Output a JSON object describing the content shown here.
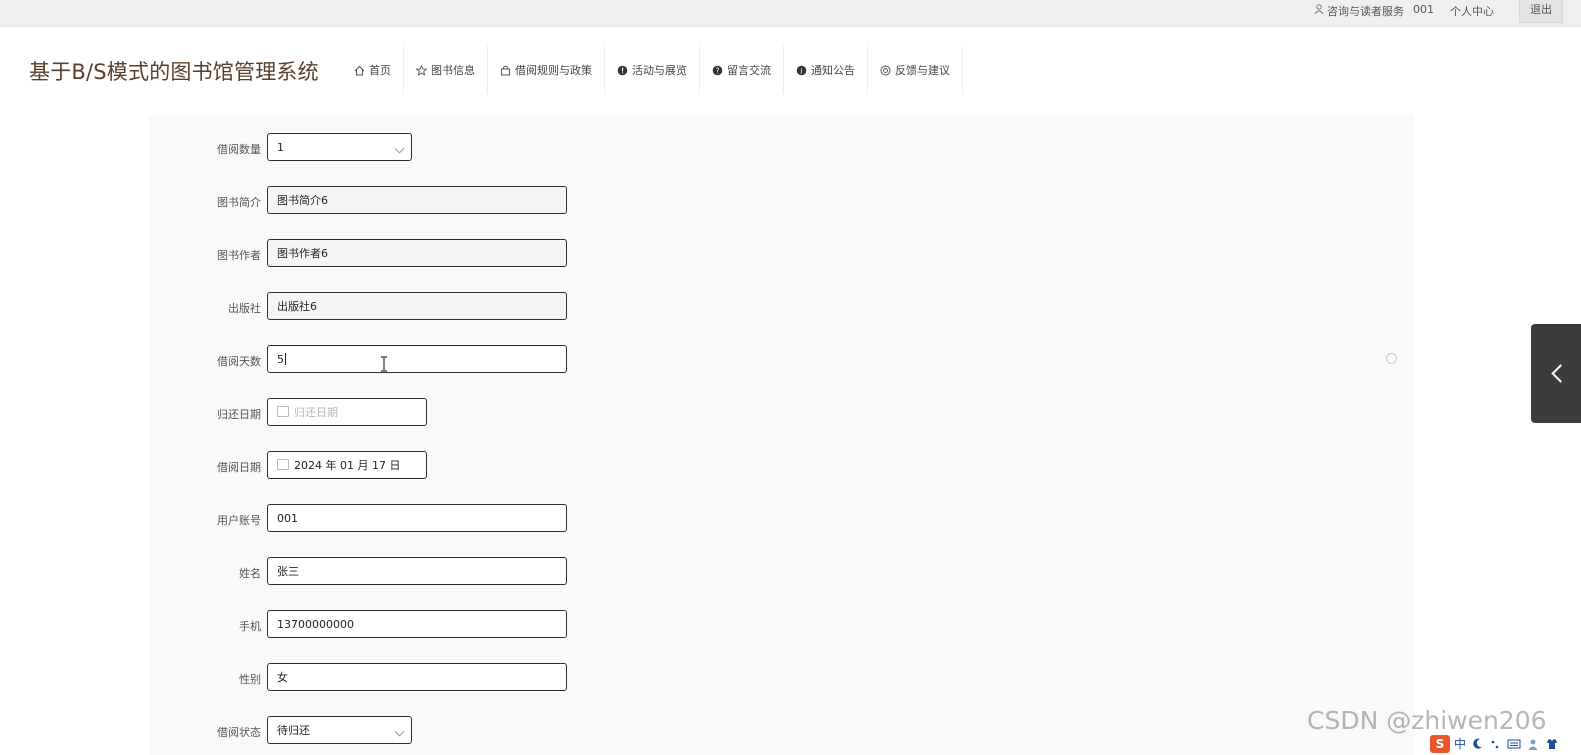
{
  "topbar": {
    "service": "咨询与读者服务",
    "username": "001",
    "profile": "个人中心",
    "logout": "退出"
  },
  "site_title": "基于B/S模式的图书馆管理系统",
  "nav": [
    {
      "label": "首页",
      "icon": "home-icon"
    },
    {
      "label": "图书信息",
      "icon": "star-icon"
    },
    {
      "label": "借阅规则与政策",
      "icon": "bag-icon"
    },
    {
      "label": "活动与展览",
      "icon": "info-icon"
    },
    {
      "label": "留言交流",
      "icon": "question-icon"
    },
    {
      "label": "通知公告",
      "icon": "info-icon"
    },
    {
      "label": "反馈与建议",
      "icon": "globe-icon"
    }
  ],
  "form": {
    "borrow_count": {
      "label": "借阅数量",
      "value": "1"
    },
    "book_intro": {
      "label": "图书简介",
      "value": "图书简介6"
    },
    "book_author": {
      "label": "图书作者",
      "value": "图书作者6"
    },
    "publisher": {
      "label": "出版社",
      "value": "出版社6"
    },
    "borrow_days": {
      "label": "借阅天数",
      "value": "5"
    },
    "return_date": {
      "label": "归还日期",
      "placeholder": "归还日期"
    },
    "borrow_date": {
      "label": "借阅日期",
      "value": "2024 年 01 月 17 日"
    },
    "user_account": {
      "label": "用户账号",
      "value": "001"
    },
    "name": {
      "label": "姓名",
      "value": "张三"
    },
    "phone": {
      "label": "手机",
      "value": "13700000000"
    },
    "gender": {
      "label": "性别",
      "value": "女"
    },
    "borrow_status": {
      "label": "借阅状态",
      "value": "待归还"
    }
  },
  "watermark": "CSDN @zhiwen206",
  "ime": {
    "mode": "中"
  },
  "colors": {
    "title": "#5a3e2b",
    "panel_bg": "#f8f9fb",
    "side_toggle": "#3c3c3c"
  }
}
